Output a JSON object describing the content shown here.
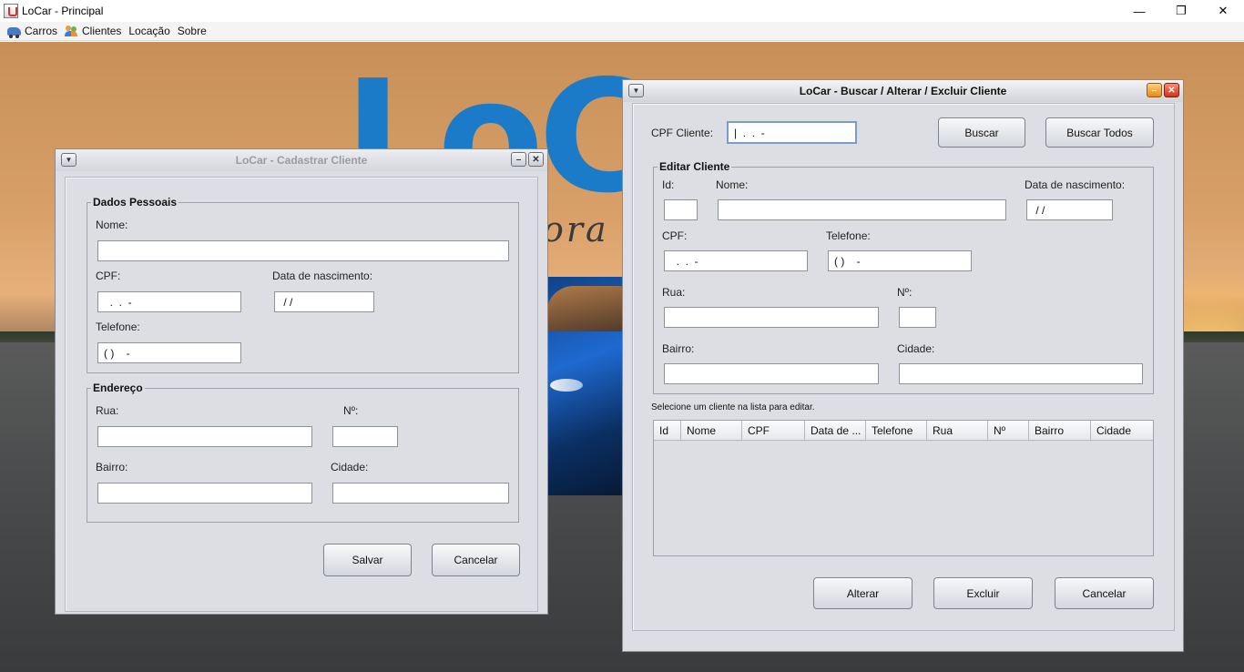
{
  "window": {
    "title": "LoCar - Principal",
    "controls": {
      "minimize": "—",
      "maximize": "❐",
      "close": "✕"
    }
  },
  "menu": [
    {
      "label": "Carros",
      "icon": "car-icon"
    },
    {
      "label": "Clientes",
      "icon": "users-icon"
    },
    {
      "label": "Locação",
      "icon": ""
    },
    {
      "label": "Sobre",
      "icon": ""
    }
  ],
  "background": {
    "logo": "LoC",
    "tagline": "ora",
    "colors": {
      "logo": "#1b7bc8"
    }
  },
  "cadastrar": {
    "title": "LoCar - Cadastrar Cliente",
    "dados_pessoais": {
      "title": "Dados Pessoais",
      "nome_label": "Nome:",
      "nome_value": "",
      "cpf_label": "CPF:",
      "cpf_value": "  .  .  -",
      "nasc_label": "Data de nascimento:",
      "nasc_value": " / /",
      "tel_label": "Telefone:",
      "tel_value": "( )    -"
    },
    "endereco": {
      "title": "Endereço",
      "rua_label": "Rua:",
      "rua_value": "",
      "num_label": "Nº:",
      "num_value": "",
      "bairro_label": "Bairro:",
      "bairro_value": "",
      "cidade_label": "Cidade:",
      "cidade_value": ""
    },
    "buttons": {
      "salvar": "Salvar",
      "cancelar": "Cancelar"
    }
  },
  "buscar": {
    "title": "LoCar - Buscar / Alterar / Excluir Cliente",
    "cpf_label": "CPF Cliente:",
    "cpf_value": "|  .  .  -",
    "btn_buscar": "Buscar",
    "btn_buscar_todos": "Buscar Todos",
    "editar": {
      "title": "Editar Cliente",
      "id_label": "Id:",
      "id_value": "",
      "nome_label": "Nome:",
      "nome_value": "",
      "nasc_label": "Data de nascimento:",
      "nasc_value": " / /",
      "cpf_label": "CPF:",
      "cpf_value": "  .  .  -",
      "tel_label": "Telefone:",
      "tel_value": "( )    -",
      "rua_label": "Rua:",
      "rua_value": "",
      "num_label": "Nº:",
      "num_value": "",
      "bairro_label": "Bairro:",
      "bairro_value": "",
      "cidade_label": "Cidade:",
      "cidade_value": ""
    },
    "hint": "Selecione um cliente na lista para editar.",
    "table": {
      "columns": [
        "Id",
        "Nome",
        "CPF",
        "Data de ...",
        "Telefone",
        "Rua",
        "Nº",
        "Bairro",
        "Cidade"
      ],
      "rows": []
    },
    "buttons": {
      "alterar": "Alterar",
      "excluir": "Excluir",
      "cancelar": "Cancelar"
    }
  }
}
